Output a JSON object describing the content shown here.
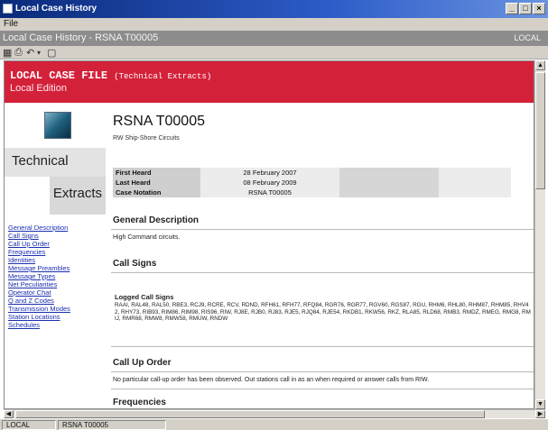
{
  "window": {
    "title": "Local Case History",
    "buttons": [
      "_",
      "□",
      "×"
    ]
  },
  "menu": {
    "items": [
      "File"
    ]
  },
  "header": {
    "breadcrumb": "Local Case History - RSNA T00005",
    "right": "LOCAL"
  },
  "banner": {
    "title": "LOCAL CASE FILE",
    "subtitle": "(Technical Extracts)",
    "edition": "Local Edition"
  },
  "sidebar": {
    "technical": "Technical",
    "extracts": "Extracts",
    "links": [
      "General Description",
      "Call Signs",
      "Call Up Order",
      "Frequencies",
      "Identities",
      "Message Preambles",
      "Message Types",
      "Net Peculiarities",
      "Operator Chat",
      "Q and Z Codes",
      "Transmission Modes",
      "Station Locations",
      "Schedules"
    ]
  },
  "case": {
    "id": "RSNA T00005",
    "subtitle": "RW Ship-Shore Circuits",
    "info": [
      {
        "label": "First Heard",
        "value": "28 February 2007"
      },
      {
        "label": "Last Heard",
        "value": "08 February 2009"
      },
      {
        "label": "Case Notation",
        "value": "RSNA T00005"
      }
    ]
  },
  "sections": {
    "general_description": {
      "heading": "General Description",
      "text": "High Command circuits."
    },
    "call_signs": {
      "heading": "Call Signs",
      "logged_label": "Logged Call Signs",
      "text": "RAAI, RAL48, RAL50, RBE3, RCJ9, RCRE, RCV, RDND, RFH61, RFH77, RFQ84, RGR76, RGR77, RGV60, RGS87, RGU, RHM6, RHL80, RHM87, RHM85, RHV42, RHY73, RIB93, RIM86, RIM98, RIS96, RIW, RJ8E, RJB0, RJ83, RJE5, RJQ84, RJE54, RKDB1, RKW56, RKZ, RLA85, RLD68, RMB3, RMDZ, RMEG, RMG8, RMIJ, RMR68, RMW8, RMW58, RMUW, RNDW"
    },
    "call_up_order": {
      "heading": "Call Up Order",
      "text": "No particular call-up order has been observed. Out stations call in as an when required or answer calls from RIW."
    },
    "frequencies": {
      "heading": "Frequencies"
    }
  },
  "status": {
    "cell1": "LOCAL",
    "cell2": "RSNA T00005"
  }
}
